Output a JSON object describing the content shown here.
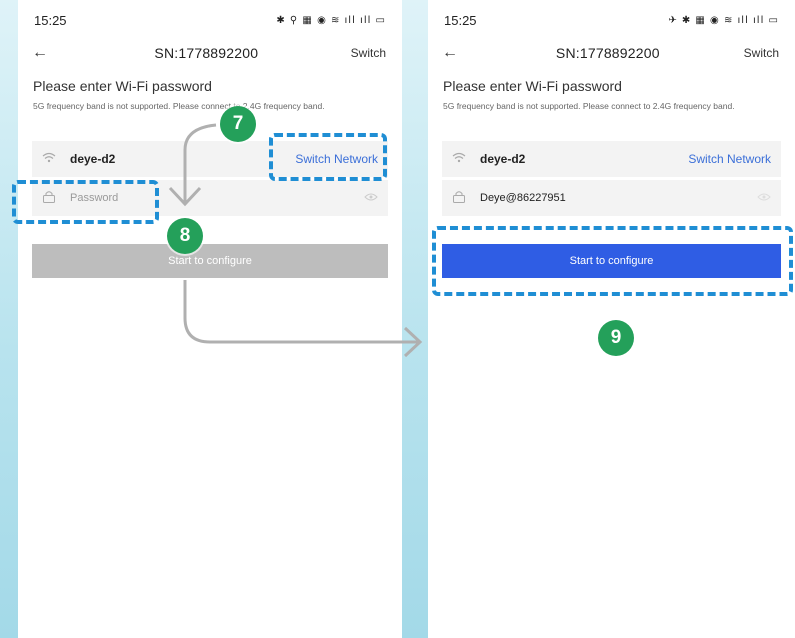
{
  "left_screen": {
    "status": {
      "time": "15:25",
      "icons": "✱ ⚲ ▦ ◉ ≋ ıll ıll ▭"
    },
    "nav": {
      "title": "SN:1778892200",
      "switch_label": "Switch"
    },
    "heading": "Please enter Wi-Fi password",
    "note": "5G frequency band is not supported. Please connect to 2.4G frequency band.",
    "network_name": "deye-d2",
    "switch_network_label": "Switch Network",
    "password_placeholder": "Password",
    "configure_label": "Start to configure"
  },
  "right_screen": {
    "status": {
      "time": "15:25",
      "icons": "✈ ✱ ▦ ◉ ≋ ıll ıll ▭"
    },
    "nav": {
      "title": "SN:1778892200",
      "switch_label": "Switch"
    },
    "heading": "Please enter Wi-Fi password",
    "note": "5G frequency band is not supported. Please connect to 2.4G frequency band.",
    "network_name": "deye-d2",
    "switch_network_label": "Switch Network",
    "password_value": "Deye@86227951",
    "configure_label": "Start to configure"
  },
  "steps": [
    "7",
    "8",
    "9"
  ],
  "colors": {
    "accent": "#2f5de4",
    "step_badge": "#24a05a",
    "highlight": "#1f8ed4",
    "disabled": "#bdbdbd"
  },
  "icons": [
    "back-arrow-icon",
    "wifi-icon",
    "lock-icon",
    "eye-icon",
    "arrow-icon"
  ]
}
